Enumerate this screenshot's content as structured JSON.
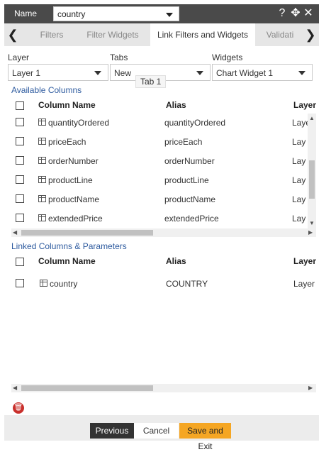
{
  "header": {
    "name_label": "Name",
    "name_value": "country",
    "help_icon": "?",
    "move_icon": "✥",
    "close_icon": "✕"
  },
  "tabs": {
    "prev_icon": "❮",
    "next_icon": "❯",
    "items": [
      {
        "label": "Filters"
      },
      {
        "label": "Filter Widgets"
      },
      {
        "label": "Link Filters and Widgets"
      },
      {
        "label": "Validati"
      }
    ]
  },
  "selectors": {
    "layer_label": "Layer",
    "layer_value": "Layer 1",
    "tabs_label": "Tabs",
    "tabs_value": "New",
    "tabs_tooltip": "Tab 1",
    "widgets_label": "Widgets",
    "widgets_value": "Chart Widget 1"
  },
  "available": {
    "title": "Available Columns",
    "headers": {
      "name": "Column Name",
      "alias": "Alias",
      "layer": "Layer"
    },
    "rows": [
      {
        "name": "quantityOrdered",
        "alias": "quantityOrdered",
        "layer": "Laye"
      },
      {
        "name": "priceEach",
        "alias": "priceEach",
        "layer": "Lay"
      },
      {
        "name": "orderNumber",
        "alias": "orderNumber",
        "layer": "Lay"
      },
      {
        "name": "productLine",
        "alias": "productLine",
        "layer": "Lay"
      },
      {
        "name": "productName",
        "alias": "productName",
        "layer": "Lay"
      },
      {
        "name": "extendedPrice",
        "alias": "extendedPrice",
        "layer": "Lay"
      }
    ]
  },
  "linked": {
    "title": "Linked Columns & Parameters",
    "headers": {
      "name": "Column Name",
      "alias": "Alias",
      "layer": "Layer"
    },
    "rows": [
      {
        "name": "country",
        "alias": "COUNTRY",
        "layer": "Layer"
      }
    ]
  },
  "footer": {
    "previous_label": "Previous",
    "cancel_label": "Cancel",
    "save_label": "Save and Exit"
  },
  "colors": {
    "header_bg": "#4a4a4a",
    "section_title": "#2e5b9f",
    "save_button": "#f5a623",
    "delete_icon": "#c9302c"
  }
}
